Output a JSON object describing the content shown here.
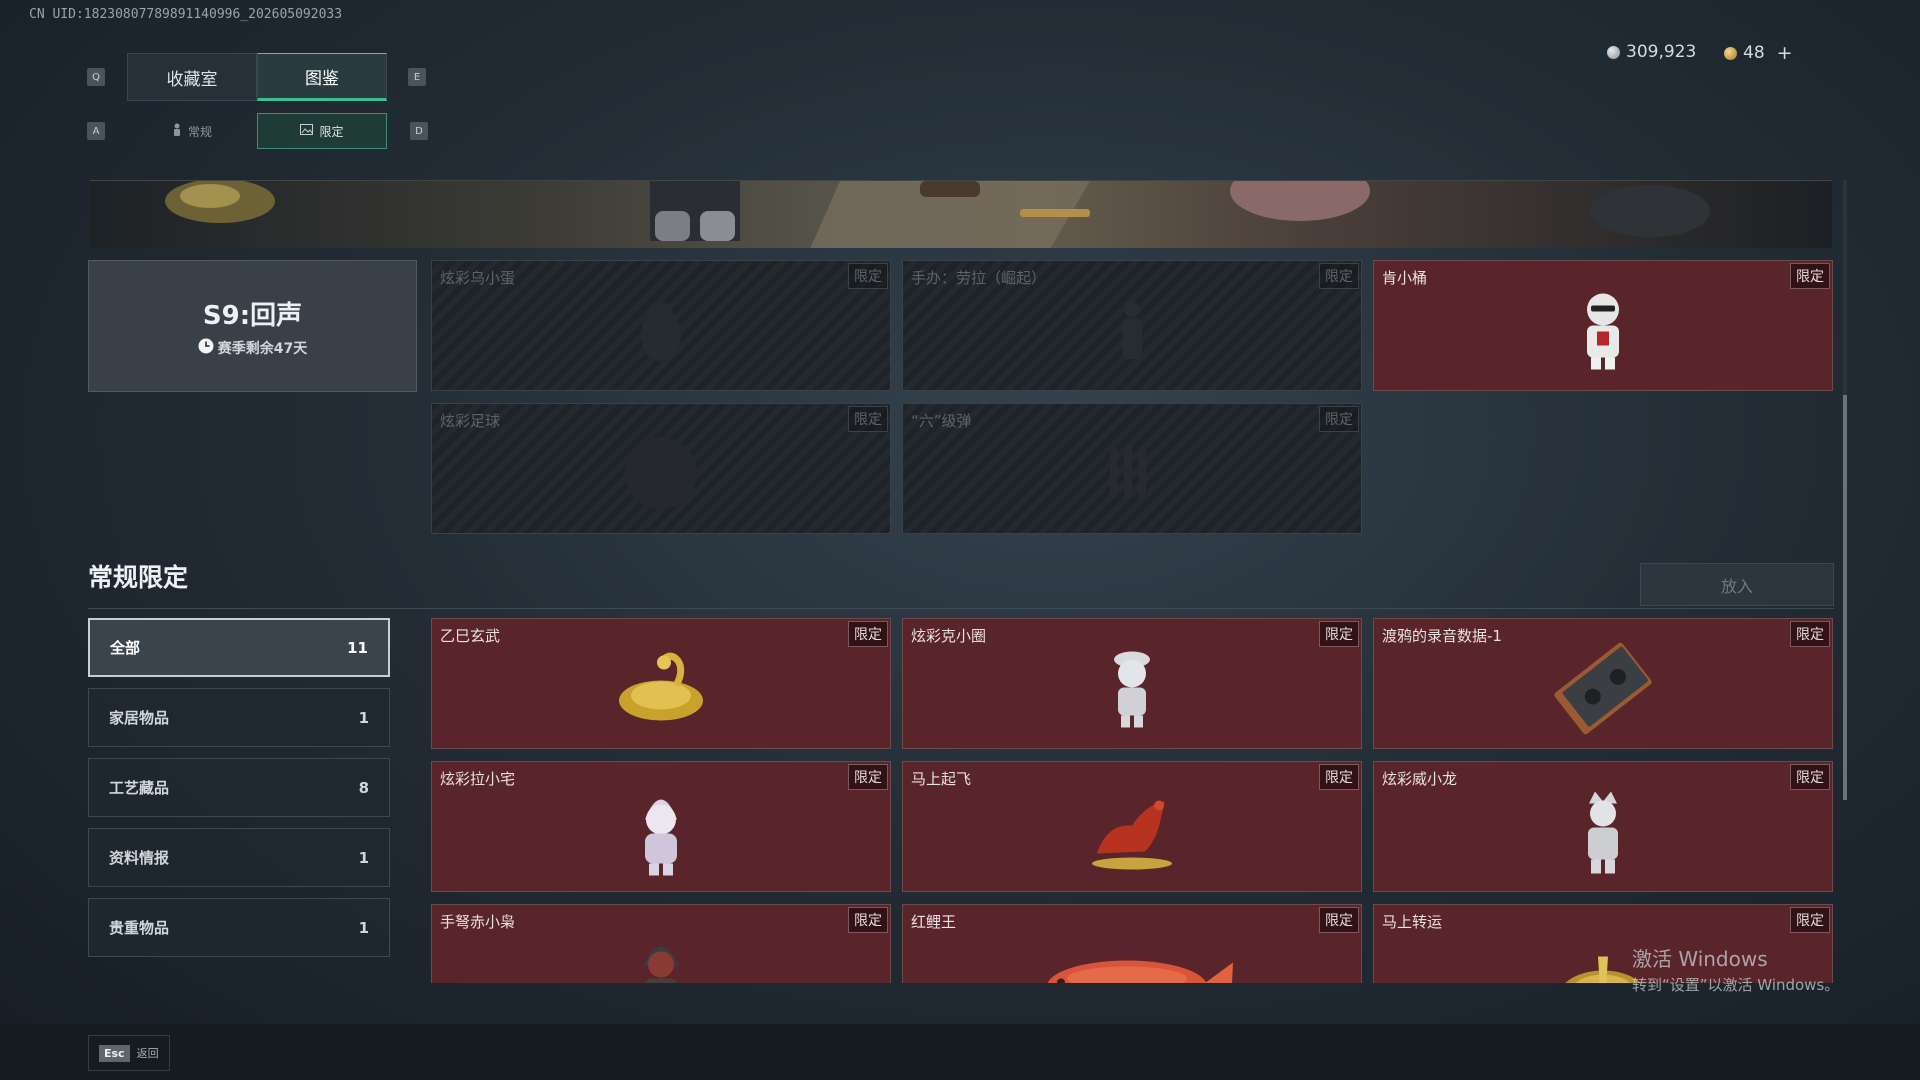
{
  "uid": "CN UID:18230807789891140996_202605092033",
  "key_hints": {
    "q": "Q",
    "e": "E",
    "a": "A",
    "d": "D"
  },
  "tabs": [
    {
      "label": "收藏室",
      "active": false
    },
    {
      "label": "图鉴",
      "active": true
    }
  ],
  "subtabs": [
    {
      "label": "常规",
      "icon": "figurine-icon",
      "active": false
    },
    {
      "label": "限定",
      "icon": "image-icon",
      "active": true
    }
  ],
  "currency": {
    "silver": "309,923",
    "gold": "48",
    "add": "+"
  },
  "season": {
    "title": "S9:回声",
    "remaining": "赛季剩余47天"
  },
  "season_items": [
    {
      "name": "炫彩乌小蛋",
      "badge": "限定",
      "locked": true
    },
    {
      "name": "手办：劳拉（崛起）",
      "badge": "限定",
      "locked": true
    },
    {
      "name": "肯小桶",
      "badge": "限定",
      "locked": false
    },
    {
      "name": "炫彩足球",
      "badge": "限定",
      "locked": true
    },
    {
      "name": "“六”级弹",
      "badge": "限定",
      "locked": true
    }
  ],
  "section": {
    "title": "常规限定",
    "put_in_button": "放入"
  },
  "categories": [
    {
      "label": "全部",
      "count": "11",
      "active": true
    },
    {
      "label": "家居物品",
      "count": "1",
      "active": false
    },
    {
      "label": "工艺藏品",
      "count": "8",
      "active": false
    },
    {
      "label": "资料情报",
      "count": "1",
      "active": false
    },
    {
      "label": "贵重物品",
      "count": "1",
      "active": false
    }
  ],
  "items": [
    {
      "name": "乙巳玄武",
      "badge": "限定",
      "icon": "gold-dragon-icon"
    },
    {
      "name": "炫彩克小圈",
      "badge": "限定",
      "icon": "figurine-icon"
    },
    {
      "name": "渡鸦的录音数据-1",
      "badge": "限定",
      "icon": "cassette-icon"
    },
    {
      "name": "炫彩拉小宅",
      "badge": "限定",
      "icon": "figurine-icon"
    },
    {
      "name": "马上起飞",
      "badge": "限定",
      "icon": "red-horse-icon"
    },
    {
      "name": "炫彩威小龙",
      "badge": "限定",
      "icon": "figurine-icon"
    },
    {
      "name": "手弩赤小枭",
      "badge": "限定",
      "icon": "figurine-icon"
    },
    {
      "name": "红鲤王",
      "badge": "限定",
      "icon": "carp-icon"
    },
    {
      "name": "马上转运",
      "badge": "限定",
      "icon": "gold-horse-icon"
    }
  ],
  "footer": {
    "esc_key": "Esc",
    "esc_label": "返回"
  },
  "watermark": {
    "line1": "激活 Windows",
    "line2": "转到“设置”以激活 Windows。"
  },
  "colors": {
    "accent": "#3bbf8e",
    "card_unlocked": "#5a242b",
    "background": "#232d36"
  }
}
